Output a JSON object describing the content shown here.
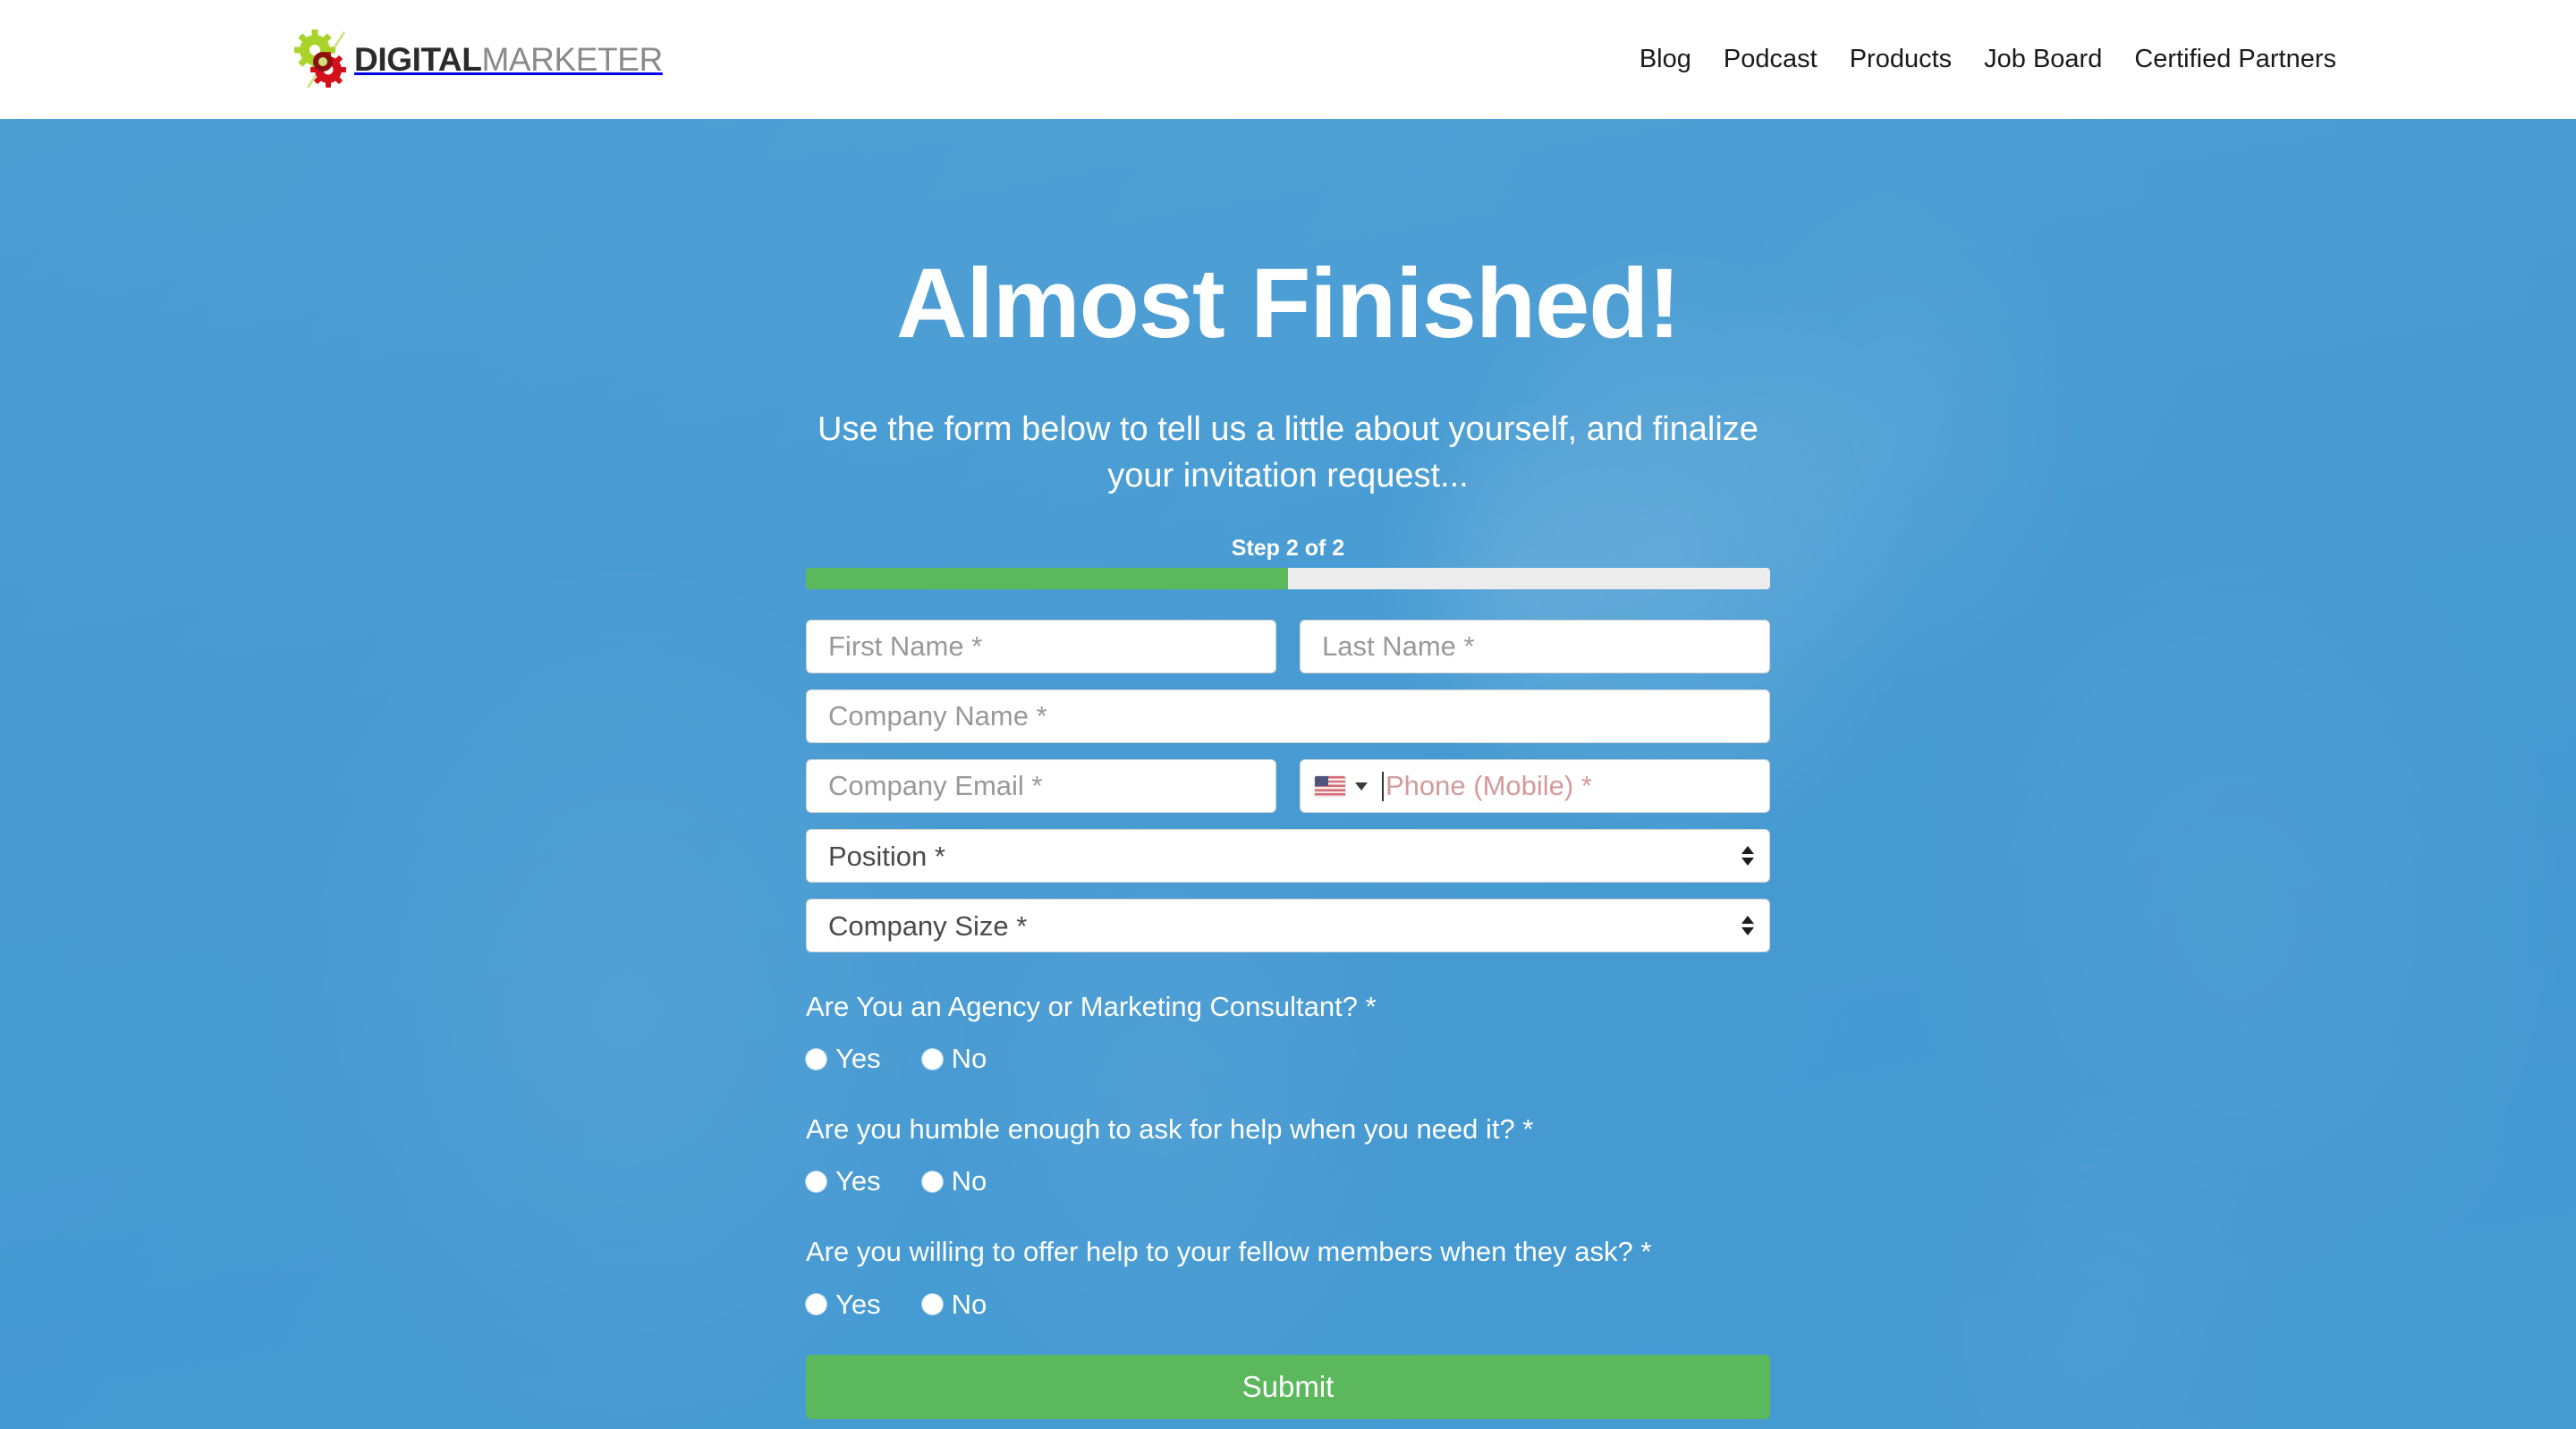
{
  "header": {
    "logo": {
      "bold_text": "DIGITAL",
      "light_text": "MARKETER",
      "gear_green": "#a9d328",
      "gear_red": "#d4101a"
    },
    "nav": [
      {
        "label": "Blog"
      },
      {
        "label": "Podcast"
      },
      {
        "label": "Products"
      },
      {
        "label": "Job Board"
      },
      {
        "label": "Certified Partners"
      }
    ]
  },
  "hero": {
    "title": "Almost Finished!",
    "subtitle": "Use the form below to tell us a little about yourself, and finalize your invitation request...",
    "step_label": "Step 2 of 2",
    "progress_percent": 50,
    "progress_color": "#5cb85c",
    "background_tint": "#4a9fd4"
  },
  "form": {
    "first_name_placeholder": "First Name *",
    "last_name_placeholder": "Last Name *",
    "company_name_placeholder": "Company Name *",
    "company_email_placeholder": "Company Email *",
    "phone_placeholder": "Phone (Mobile) *",
    "phone_country_flag": "us-flag-icon",
    "position_label": "Position *",
    "company_size_label": "Company Size *",
    "questions": [
      {
        "text": "Are You an Agency or Marketing Consultant? *",
        "options": [
          {
            "label": "Yes"
          },
          {
            "label": "No"
          }
        ]
      },
      {
        "text": "Are you humble enough to ask for help when you need it? *",
        "options": [
          {
            "label": "Yes"
          },
          {
            "label": "No"
          }
        ]
      },
      {
        "text": "Are you willing to offer help to your fellow members when they ask? *",
        "options": [
          {
            "label": "Yes"
          },
          {
            "label": "No"
          }
        ]
      }
    ],
    "submit_label": "Submit"
  }
}
